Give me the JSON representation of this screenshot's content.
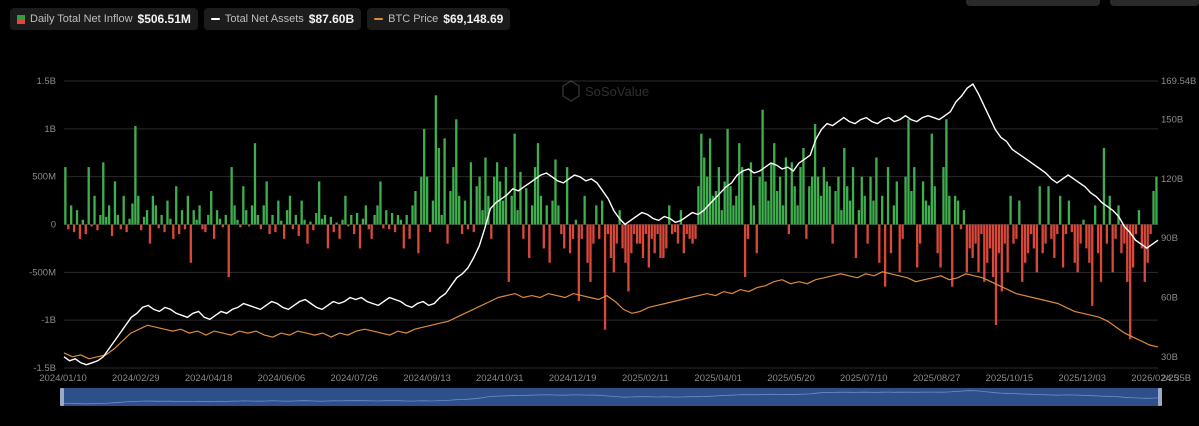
{
  "legend": {
    "inflow": {
      "label": "Daily Total Net Inflow",
      "value": "$506.51M"
    },
    "assets": {
      "label": "Total Net Assets",
      "value": "$87.60B"
    },
    "btc": {
      "label": "BTC Price",
      "value": "$69,148.69"
    }
  },
  "watermark": "SoSoValue",
  "colors": {
    "positive": "#3fae4f",
    "negative": "#d9483b",
    "assets": "#ffffff",
    "btc": "#d98c3d",
    "grid": "#2b2b2b",
    "navigator": "#2d4f8a"
  },
  "chart_data": {
    "type": "bar",
    "x_ticks": [
      "2024/01/10",
      "2024/02/29",
      "2024/04/18",
      "2024/06/06",
      "2024/07/26",
      "2024/09/13",
      "2024/10/31",
      "2024/12/19",
      "2025/02/11",
      "2025/04/01",
      "2025/05/20",
      "2025/07/10",
      "2025/08/27",
      "2025/10/15",
      "2025/12/03",
      "2026/02/25"
    ],
    "y_left_ticks": [
      "1.5B",
      "1B",
      "500M",
      "0",
      "-500M",
      "-1B",
      "-1.5B"
    ],
    "y_right_ticks": [
      "169.54B",
      "150B",
      "120B",
      "90B",
      "60B",
      "30B",
      "24.35B"
    ],
    "y_left_range": [
      -1500,
      1500
    ],
    "y_right_range": [
      24.35,
      169.54
    ],
    "left_unit": "USD millions",
    "right_unit": "USD billions",
    "series": [
      {
        "name": "Daily Total Net Inflow",
        "type": "bar",
        "values": [
          600,
          -50,
          200,
          -80,
          150,
          -150,
          50,
          -100,
          600,
          -20,
          300,
          -60,
          100,
          650,
          80,
          200,
          -120,
          450,
          100,
          -50,
          300,
          -80,
          60,
          220,
          1030,
          300,
          -60,
          80,
          150,
          -200,
          300,
          200,
          -40,
          100,
          -80,
          250,
          60,
          -150,
          400,
          -100,
          150,
          -50,
          300,
          -400,
          150,
          50,
          200,
          -50,
          -80,
          100,
          350,
          -150,
          150,
          60,
          -30,
          100,
          -550,
          600,
          200,
          50,
          -30,
          400,
          150,
          -20,
          200,
          850,
          100,
          -50,
          200,
          450,
          -100,
          100,
          -80,
          250,
          40,
          -150,
          150,
          300,
          -50,
          100,
          -120,
          250,
          50,
          -200,
          30,
          -60,
          120,
          450,
          60,
          100,
          -250,
          80,
          -80,
          20,
          -150,
          50,
          300,
          -20,
          100,
          -100,
          120,
          -250,
          60,
          200,
          -50,
          -150,
          100,
          200,
          450,
          -40,
          150,
          -50,
          120,
          -80,
          100,
          50,
          -250,
          100,
          -150,
          200,
          350,
          -300,
          500,
          1000,
          500,
          -80,
          250,
          1350,
          800,
          100,
          900,
          -200,
          350,
          600,
          1100,
          300,
          -100,
          250,
          -50,
          650,
          -80,
          400,
          500,
          150,
          700,
          300,
          -150,
          500,
          650,
          450,
          250,
          600,
          -600,
          300,
          950,
          150,
          550,
          -150,
          380,
          -350,
          200,
          600,
          850,
          300,
          -250,
          200,
          -400,
          250,
          680,
          200,
          -100,
          -250,
          600,
          -300,
          -150,
          50,
          -800,
          -150,
          300,
          -400,
          -600,
          -200,
          200,
          -150,
          250,
          -1100,
          -100,
          -350,
          -500,
          -200,
          150,
          -250,
          -400,
          -700,
          -300,
          -100,
          -200,
          -200,
          -350,
          -100,
          -450,
          -150,
          -300,
          -100,
          -350,
          -350,
          -250,
          200,
          -100,
          -80,
          -200,
          150,
          -300,
          -100,
          -150,
          -200,
          -150,
          400,
          950,
          700,
          500,
          900,
          300,
          350,
          600,
          150,
          450,
          1000,
          400,
          200,
          300,
          850,
          600,
          -550,
          -150,
          650,
          200,
          -300,
          500,
          1200,
          450,
          250,
          650,
          850,
          350,
          500,
          200,
          700,
          -100,
          650,
          400,
          200,
          600,
          800,
          -150,
          400,
          500,
          1050,
          500,
          300,
          600,
          450,
          400,
          -200,
          350,
          500,
          150,
          800,
          400,
          250,
          600,
          -350,
          150,
          500,
          300,
          -200,
          500,
          250,
          700,
          -400,
          300,
          -650,
          600,
          -300,
          200,
          450,
          -500,
          -150,
          500,
          1100,
          350,
          600,
          -450,
          -200,
          450,
          250,
          200,
          950,
          400,
          -300,
          -450,
          600,
          1100,
          300,
          -650,
          300,
          250,
          -50,
          150,
          -500,
          -250,
          -350,
          -200,
          -500,
          -100,
          -600,
          -400,
          -250,
          -550,
          -1050,
          -300,
          -700,
          -200,
          -500,
          300,
          -200,
          -150,
          250,
          -600,
          -400,
          -300,
          -100,
          -250,
          -500,
          400,
          -300,
          -200,
          400,
          -150,
          -350,
          -100,
          300,
          -450,
          -100,
          250,
          -80,
          -400,
          -500,
          -200,
          50,
          -250,
          -400,
          -850,
          200,
          -300,
          -600,
          800,
          -200,
          300,
          -500,
          -150,
          200,
          -300,
          -200,
          -600,
          -1200,
          -450,
          -100,
          150,
          -250,
          -600,
          -400,
          -100,
          350,
          500
        ]
      },
      {
        "name": "Total Net Assets",
        "type": "line",
        "axis": "right",
        "values": [
          30,
          28,
          29,
          27,
          26,
          27,
          28,
          30,
          34,
          38,
          42,
          46,
          50,
          52,
          55,
          56,
          54,
          53,
          55,
          54,
          52,
          51,
          50,
          52,
          53,
          50,
          49,
          51,
          53,
          52,
          54,
          55,
          57,
          56,
          55,
          54,
          56,
          58,
          57,
          55,
          54,
          56,
          58,
          59,
          57,
          55,
          54,
          56,
          58,
          57,
          58,
          60,
          59,
          60,
          58,
          57,
          56,
          58,
          60,
          59,
          58,
          56,
          55,
          57,
          58,
          56,
          57,
          60,
          62,
          66,
          70,
          72,
          75,
          80,
          86,
          95,
          105,
          108,
          110,
          112,
          115,
          114,
          116,
          118,
          120,
          122,
          123,
          121,
          119,
          118,
          120,
          122,
          121,
          119,
          120,
          118,
          114,
          110,
          104,
          100,
          97,
          99,
          101,
          103,
          102,
          100,
          99,
          101,
          100,
          98,
          99,
          101,
          103,
          102,
          104,
          107,
          110,
          113,
          116,
          118,
          122,
          124,
          125,
          123,
          124,
          126,
          128,
          127,
          125,
          126,
          124,
          128,
          130,
          132,
          140,
          145,
          148,
          147,
          149,
          151,
          149,
          148,
          150,
          151,
          149,
          148,
          150,
          151,
          149,
          150,
          152,
          150,
          149,
          151,
          152,
          151,
          150,
          152,
          154,
          159,
          162,
          166,
          168,
          163,
          157,
          151,
          145,
          141,
          139,
          135,
          133,
          131,
          129,
          127,
          125,
          123,
          120,
          118,
          120,
          122,
          120,
          118,
          116,
          113,
          111,
          108,
          106,
          104,
          101,
          96,
          93,
          89,
          87,
          85,
          87,
          89
        ]
      },
      {
        "name": "BTC Price",
        "type": "line",
        "axis": "right",
        "values": [
          32,
          30,
          31,
          29,
          30,
          31,
          34,
          38,
          42,
          44,
          46,
          45,
          44,
          43,
          44,
          42,
          43,
          41,
          43,
          42,
          41,
          43,
          42,
          43,
          41,
          40,
          42,
          41,
          43,
          42,
          41,
          42,
          40,
          42,
          41,
          43,
          44,
          43,
          42,
          41,
          43,
          42,
          44,
          45,
          46,
          47,
          48,
          50,
          52,
          54,
          56,
          58,
          60,
          61,
          62,
          60,
          61,
          60,
          62,
          61,
          60,
          62,
          61,
          60,
          59,
          61,
          58,
          54,
          52,
          53,
          55,
          56,
          57,
          58,
          59,
          60,
          61,
          62,
          61,
          63,
          62,
          64,
          63,
          65,
          66,
          68,
          69,
          67,
          68,
          67,
          69,
          70,
          71,
          72,
          71,
          70,
          72,
          71,
          73,
          72,
          71,
          70,
          68,
          69,
          70,
          71,
          69,
          70,
          72,
          71,
          70,
          68,
          66,
          64,
          62,
          61,
          60,
          59,
          58,
          57,
          55,
          53,
          52,
          51,
          50,
          48,
          45,
          42,
          40,
          38,
          36,
          35
        ]
      }
    ]
  }
}
